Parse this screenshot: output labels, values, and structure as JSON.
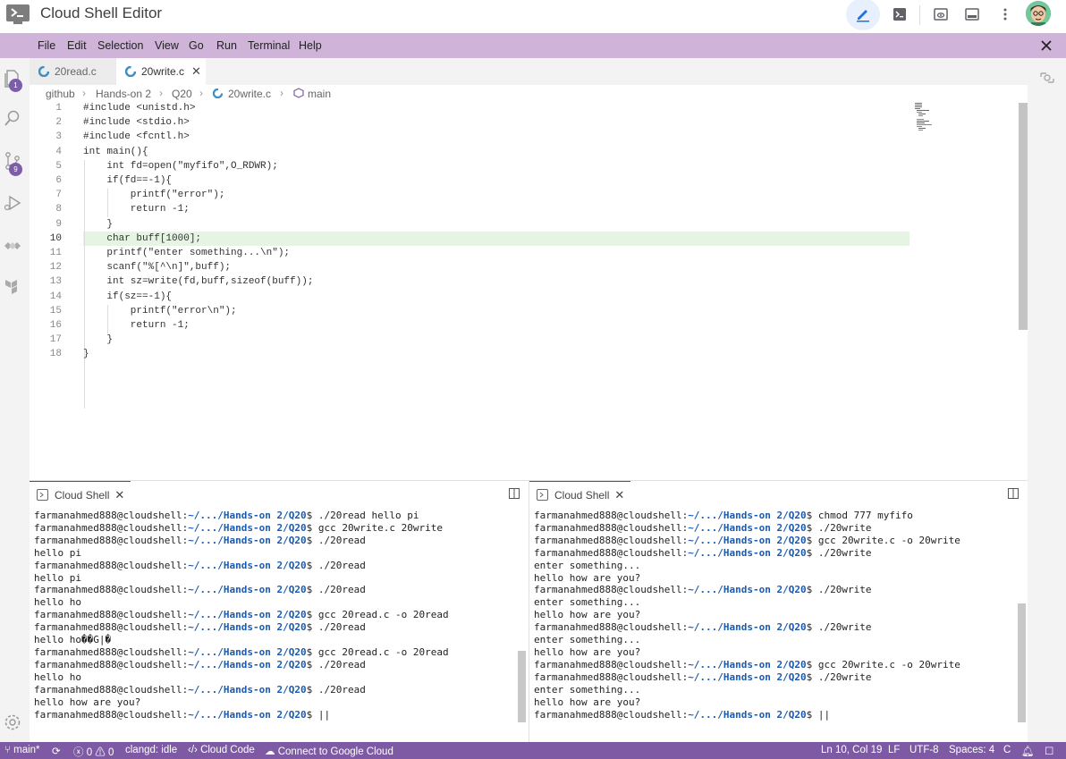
{
  "app": {
    "title": "Cloud Shell Editor"
  },
  "menu": {
    "items": [
      "File",
      "Edit",
      "Selection",
      "View",
      "Go",
      "Run",
      "Terminal",
      "Help"
    ]
  },
  "activity": {
    "explorer_badge": "1",
    "scm_badge": "9"
  },
  "tabs": [
    {
      "label": "20read.c",
      "active": false
    },
    {
      "label": "20write.c",
      "active": true
    }
  ],
  "breadcrumb": {
    "items": [
      "github",
      "Hands-on 2",
      "Q20",
      "20write.c",
      "main"
    ]
  },
  "editor": {
    "active_line": 10,
    "lines": [
      "#include <unistd.h>",
      "#include <stdio.h>",
      "#include <fcntl.h>",
      "int main(){",
      "    int fd=open(\"myfifo\",O_RDWR);",
      "    if(fd==-1){",
      "        printf(\"error\");",
      "        return -1;",
      "    }",
      "    char buff[1000];",
      "    printf(\"enter something...\\n\");",
      "    scanf(\"%[^\\n]\",buff);",
      "    int sz=write(fd,buff,sizeof(buff));",
      "    if(sz==-1){",
      "        printf(\"error\\n\");",
      "        return -1;",
      "    }",
      "}"
    ]
  },
  "terminals": [
    {
      "tab_label": "Cloud Shell",
      "prompt_user": "farmanahmed888@cloudshell:",
      "prompt_path": "~/.../Hands-on 2/Q20",
      "lines": [
        {
          "prompt": true,
          "cmd": "$ ./20read hello pi"
        },
        {
          "prompt": true,
          "cmd": "$ gcc 20write.c 20write"
        },
        {
          "prompt": true,
          "cmd": "$ ./20read"
        },
        {
          "prompt": false,
          "text": "hello pi"
        },
        {
          "prompt": true,
          "cmd": "$ ./20read"
        },
        {
          "prompt": false,
          "text": "hello pi"
        },
        {
          "prompt": true,
          "cmd": "$ ./20read"
        },
        {
          "prompt": false,
          "text": "hello ho"
        },
        {
          "prompt": true,
          "cmd": "$ gcc 20read.c -o 20read"
        },
        {
          "prompt": true,
          "cmd": "$ ./20read"
        },
        {
          "prompt": false,
          "text": "hello ho��G|�"
        },
        {
          "prompt": true,
          "cmd": "$ gcc 20read.c -o 20read"
        },
        {
          "prompt": true,
          "cmd": "$ ./20read"
        },
        {
          "prompt": false,
          "text": "hello ho"
        },
        {
          "prompt": true,
          "cmd": "$ ./20read"
        },
        {
          "prompt": false,
          "text": "hello how are you?"
        },
        {
          "prompt": true,
          "cmd": "$ ||"
        }
      ]
    },
    {
      "tab_label": "Cloud Shell",
      "prompt_user": "farmanahmed888@cloudshell:",
      "prompt_path": "~/.../Hands-on 2/Q20",
      "lines": [
        {
          "prompt": true,
          "cmd": "$ chmod 777 myfifo"
        },
        {
          "prompt": true,
          "cmd": "$ ./20write"
        },
        {
          "prompt": true,
          "cmd": "$ gcc 20write.c -o 20write"
        },
        {
          "prompt": true,
          "cmd": "$ ./20write"
        },
        {
          "prompt": false,
          "text": "enter something..."
        },
        {
          "prompt": false,
          "text": "hello how are you?"
        },
        {
          "prompt": true,
          "cmd": "$ ./20write"
        },
        {
          "prompt": false,
          "text": "enter something..."
        },
        {
          "prompt": false,
          "text": "hello how are you?"
        },
        {
          "prompt": true,
          "cmd": "$ ./20write"
        },
        {
          "prompt": false,
          "text": "enter something..."
        },
        {
          "prompt": false,
          "text": "hello how are you?"
        },
        {
          "prompt": true,
          "cmd": "$ gcc 20write.c -o 20write"
        },
        {
          "prompt": true,
          "cmd": "$ ./20write"
        },
        {
          "prompt": false,
          "text": "enter something..."
        },
        {
          "prompt": false,
          "text": "hello how are you?"
        },
        {
          "prompt": true,
          "cmd": "$ ||"
        }
      ]
    }
  ],
  "status": {
    "branch": "main*",
    "problems": "0",
    "warnings": "0",
    "clangd": "clangd: idle",
    "cloud_code": "Cloud Code",
    "connect": "Connect to Google Cloud",
    "position": "Ln 10, Col 19",
    "eol": "LF",
    "encoding": "UTF-8",
    "spaces": "Spaces: 4",
    "language": "C"
  },
  "colors": {
    "menubar": "#cfb3d9",
    "statusbar": "#7e5aa5",
    "accent": "#1a73e8"
  }
}
